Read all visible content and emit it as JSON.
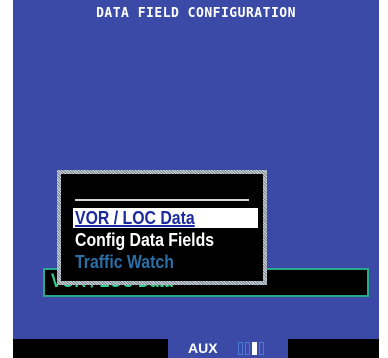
{
  "screen": {
    "title": "DATA FIELD CONFIGURATION"
  },
  "data_field": {
    "value": "VOR / LOC Data"
  },
  "menu": {
    "items": [
      {
        "label": "VOR / LOC Data",
        "state": "selected"
      },
      {
        "label": "Config Data Fields",
        "state": "enabled"
      },
      {
        "label": "Traffic Watch",
        "state": "disabled"
      }
    ]
  },
  "statusbar": {
    "page_group": "AUX",
    "page_count": 4,
    "active_page": 3
  },
  "colors": {
    "background": "#3a4aa6",
    "highlight_text": "#1b2a9e",
    "data_green": "#2fd08a",
    "disabled": "#2a6fa6"
  }
}
